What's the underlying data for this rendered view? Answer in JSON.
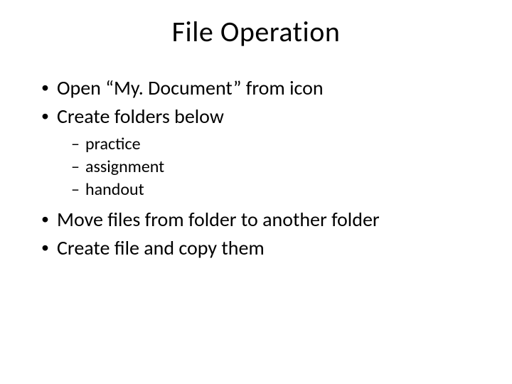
{
  "title": "File Operation",
  "bullets": {
    "item0": "Open “My. Document” from icon",
    "item1": "Create folders below",
    "sub": {
      "s0": "practice",
      "s1": "assignment",
      "s2": "handout"
    },
    "item2": "Move files from folder to another folder",
    "item3": "Create file and copy them"
  }
}
